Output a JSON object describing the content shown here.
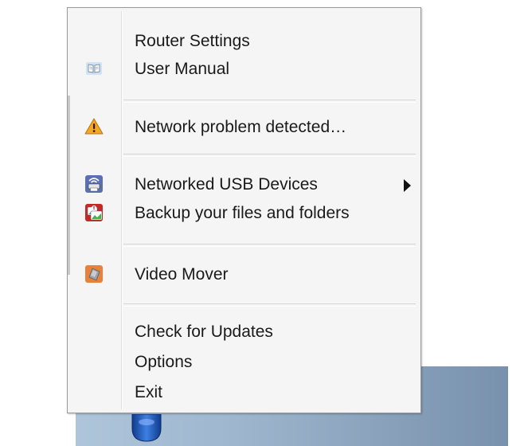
{
  "menu": {
    "items": [
      {
        "id": "router-settings",
        "label": "Router Settings",
        "icon": null
      },
      {
        "id": "user-manual",
        "label": "User Manual",
        "icon": "book-icon"
      },
      {
        "id": "network-problem",
        "label": "Network problem detected…",
        "icon": "warning-icon"
      },
      {
        "id": "networked-usb-devices",
        "label": "Networked USB Devices",
        "icon": "usb-printer-icon",
        "has_submenu": true
      },
      {
        "id": "backup-files",
        "label": "Backup your files and folders",
        "icon": "backup-icon"
      },
      {
        "id": "video-mover",
        "label": "Video Mover",
        "icon": "video-mover-icon"
      },
      {
        "id": "check-updates",
        "label": "Check for Updates",
        "icon": null
      },
      {
        "id": "options",
        "label": "Options",
        "icon": null
      },
      {
        "id": "exit",
        "label": "Exit",
        "icon": null
      }
    ]
  },
  "colors": {
    "menu_background": "#f5f5f5",
    "menu_border": "#9a9a9a",
    "warning": "#f5a623",
    "taskbar_start": "#aec5da",
    "taskbar_end": "#7891ad",
    "tray_icon": "#2b63c9"
  }
}
